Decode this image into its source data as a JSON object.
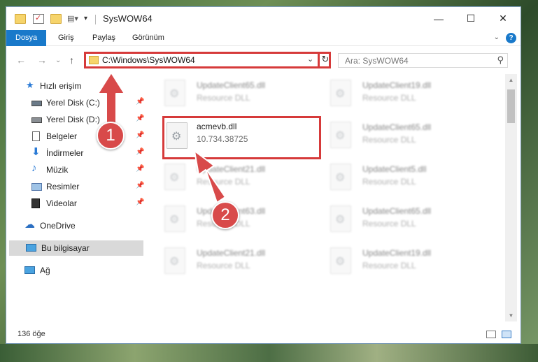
{
  "window": {
    "title": "SysWOW64"
  },
  "ribbon": {
    "tabs": [
      "Dosya",
      "Giriş",
      "Paylaş",
      "Görünüm"
    ]
  },
  "address": {
    "path": "C:\\Windows\\SysWOW64"
  },
  "search": {
    "placeholder": "Ara: SysWOW64"
  },
  "sidebar": {
    "items": [
      {
        "label": "Hızlı erişim",
        "icon": "star-icon"
      },
      {
        "label": "Yerel Disk (C:)",
        "icon": "drive-icon",
        "pinned": true
      },
      {
        "label": "Yerel Disk (D:)",
        "icon": "drive-icon",
        "pinned": true
      },
      {
        "label": "Belgeler",
        "icon": "documents-icon",
        "pinned": true
      },
      {
        "label": "İndirmeler",
        "icon": "download-icon",
        "pinned": true
      },
      {
        "label": "Müzik",
        "icon": "music-icon",
        "pinned": true
      },
      {
        "label": "Resimler",
        "icon": "pictures-icon",
        "pinned": true
      },
      {
        "label": "Videolar",
        "icon": "video-icon",
        "pinned": true
      },
      {
        "label": "OneDrive",
        "icon": "cloud-icon"
      },
      {
        "label": "Bu bilgisayar",
        "icon": "computer-icon",
        "selected": true
      },
      {
        "label": "Ağ",
        "icon": "network-icon"
      }
    ]
  },
  "files": {
    "highlighted": {
      "name": "acmevb.dll",
      "desc": "10.734.38725"
    },
    "left": [
      {
        "name": "UpdateClient65.dll",
        "desc": "Resource DLL"
      },
      {
        "name": "UpdateClient21.dll",
        "desc": "Resource DLL"
      },
      {
        "name": "UpdateClient63.dll",
        "desc": "Resource DLL"
      },
      {
        "name": "UpdateClient21.dll",
        "desc": "Resource DLL"
      }
    ],
    "right": [
      {
        "name": "UpdateClient19.dll",
        "desc": "Resource DLL"
      },
      {
        "name": "UpdateClient65.dll",
        "desc": "Resource DLL"
      },
      {
        "name": "UpdateClient5.dll",
        "desc": "Resource DLL"
      },
      {
        "name": "UpdateClient65.dll",
        "desc": "Resource DLL"
      },
      {
        "name": "UpdateClient19.dll",
        "desc": "Resource DLL"
      }
    ]
  },
  "status": {
    "count": "136 öğe"
  },
  "callouts": [
    "1",
    "2"
  ],
  "colors": {
    "accent": "#1979ca",
    "callout": "#d84a4a",
    "highlight": "#d63a3a"
  }
}
